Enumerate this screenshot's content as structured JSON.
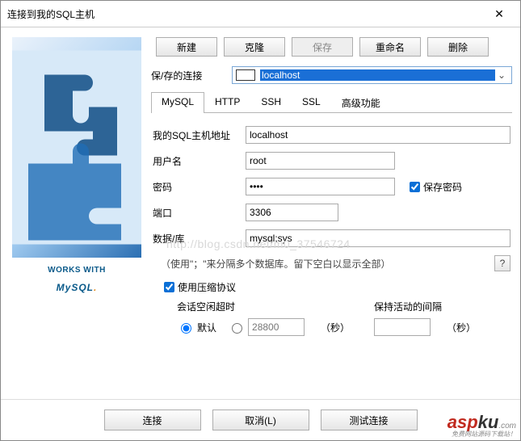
{
  "title": "连接到我的SQL主机",
  "topButtons": {
    "new": "新建",
    "clone": "克隆",
    "save": "保存",
    "rename": "重命名",
    "delete": "删除"
  },
  "savedConn": {
    "label": "保/存的连接",
    "value": "localhost"
  },
  "tabs": {
    "mysql": "MySQL",
    "http": "HTTP",
    "ssh": "SSH",
    "ssl": "SSL",
    "adv": "高级功能"
  },
  "fields": {
    "host": {
      "label": "我的SQL主机地址",
      "value": "localhost"
    },
    "user": {
      "label": "用户名",
      "value": "root"
    },
    "password": {
      "label": "密码",
      "value": "••••"
    },
    "savePassword": "保存密码",
    "port": {
      "label": "端口",
      "value": "3306"
    },
    "database": {
      "label": "数据/库",
      "value": "mysql;sys"
    }
  },
  "hint": "（使用\"；\"来分隔多个数据库。留下空白以显示全部）",
  "helpQ": "?",
  "compress": "使用压缩协议",
  "idle": {
    "timeoutLabel": "会话空闲超时",
    "defaultLabel": "默认",
    "numValue": "28800",
    "secUnit": "（秒）",
    "keepaliveLabel": "保持活动的间隔",
    "kaValue": ""
  },
  "footer": {
    "connect": "连接",
    "cancel": "取消(L)",
    "test": "测试连接"
  },
  "logo": {
    "works": "WORKS WITH",
    "mysql": "MySQL"
  },
  "watermark": {
    "asp": "asp",
    "ku": "ku",
    "com": ".com",
    "sub": "免费网站源码下载站！"
  },
  "ghost": "http://blog.csdn.net/m0_37546724"
}
